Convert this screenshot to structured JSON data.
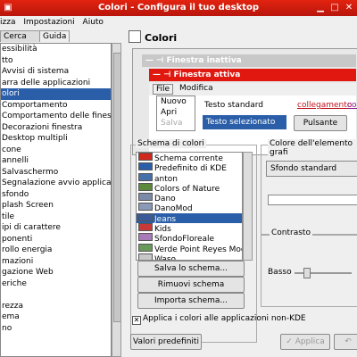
{
  "window": {
    "title": "Colori - Configura il tuo desktop"
  },
  "menubar": {
    "items": [
      "izza",
      "Impostazioni",
      "Aiuto"
    ]
  },
  "tabs": [
    "Cerca",
    "Guida"
  ],
  "sidebar": {
    "items": [
      "essibilità",
      "tto",
      "Avvisi di sistema",
      "arra delle applicazioni",
      "olori",
      "Comportamento",
      "Comportamento delle finestre",
      "Decorazioni finestra",
      "Desktop multipli",
      "cone",
      "annelli",
      "Salvaschermo",
      "Segnalazione avvio applicazioni",
      "sfondo",
      "plash Screen",
      "tile",
      "ipi di carattere",
      "ponenti",
      "rollo energia",
      "mazioni",
      "gazione Web",
      "eriche",
      "",
      "rezza",
      "ema",
      "no"
    ],
    "selected_index": 4
  },
  "header": {
    "title": "Colori"
  },
  "preview": {
    "inactive_title": "Finestra inattiva",
    "active_title": "Finestra attiva",
    "menu": [
      "File",
      "Modifica"
    ],
    "dropdown_items": [
      "Nuovo",
      "Apri",
      "Salva"
    ],
    "standard_text": "Testo standard",
    "link_text": "collegamento",
    "visited_partial": "colo",
    "selected_text": "Testo selezionato",
    "button_label": "Pulsante"
  },
  "scheme": {
    "group_title": "Schema di colori",
    "items": [
      {
        "name": "Schema corrente",
        "color": "#d0281c"
      },
      {
        "name": "Predefinito di KDE",
        "color": "#2a5ea8"
      },
      {
        "name": "anton",
        "color": "#4870a8"
      },
      {
        "name": "Colors of Nature",
        "color": "#5a8a3a"
      },
      {
        "name": "Dano",
        "color": "#7a8aa8"
      },
      {
        "name": "DanoMod",
        "color": "#8a9ab8"
      },
      {
        "name": "Jeans",
        "color": "#3a5a9a"
      },
      {
        "name": "Kids",
        "color": "#c83a3a"
      },
      {
        "name": "SfondoFloreale",
        "color": "#a87ab8"
      },
      {
        "name": "Verde Point Reyes Mod1",
        "color": "#6a9a5a"
      },
      {
        "name": "Waso",
        "color": "#c8c8c8"
      }
    ],
    "selected_index": 6,
    "save_label": "Salva lo schema...",
    "remove_label": "Rimuovi schema",
    "import_label": "Importa schema..."
  },
  "widget_color": {
    "group_title": "Colore dell'elemento grafi",
    "combo_value": "Sfondo standard"
  },
  "contrast": {
    "group_title": "Contrasto",
    "low_label": "Basso",
    "level": 0.17
  },
  "apply_nonkde": {
    "label": "Applica i colori alle applicazioni non-KDE",
    "checked": true
  },
  "footer": {
    "defaults_label": "Valori predefiniti",
    "apply_label": "Applica",
    "reset_label": "Ripristina"
  }
}
